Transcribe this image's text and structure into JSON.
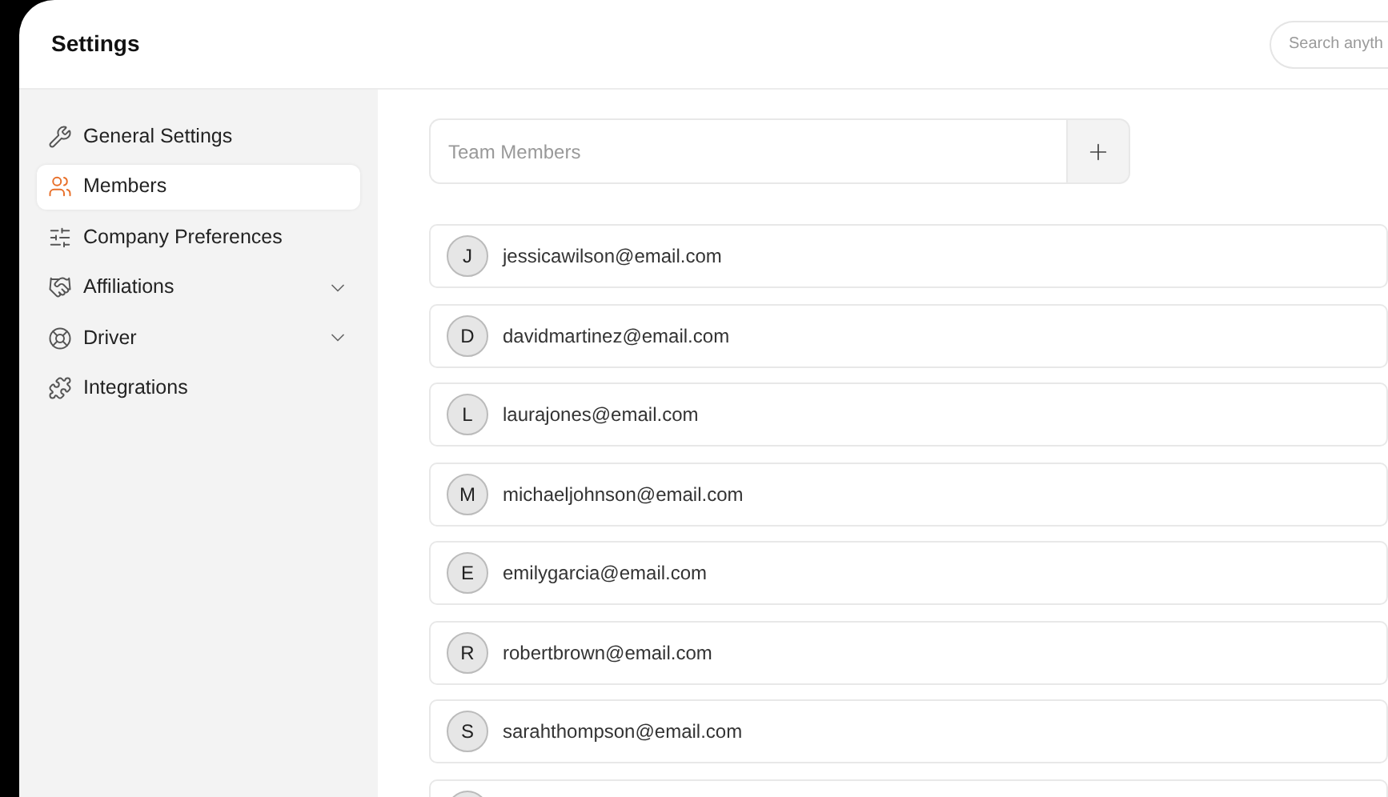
{
  "header": {
    "title": "Settings",
    "search": {
      "placeholder": "Search anyth"
    }
  },
  "sidebar": {
    "items": [
      {
        "label": "General Settings",
        "selected": false,
        "expandable": false
      },
      {
        "label": "Members",
        "selected": true,
        "expandable": false
      },
      {
        "label": "Company Preferences",
        "selected": false,
        "expandable": false
      },
      {
        "label": "Affiliations",
        "selected": false,
        "expandable": true
      },
      {
        "label": "Driver",
        "selected": false,
        "expandable": true
      },
      {
        "label": "Integrations",
        "selected": false,
        "expandable": false
      }
    ]
  },
  "team_input": {
    "placeholder": "Team Members"
  },
  "members": [
    {
      "initial": "J",
      "email": "jessicawilson@email.com"
    },
    {
      "initial": "D",
      "email": "davidmartinez@email.com"
    },
    {
      "initial": "L",
      "email": "laurajones@email.com"
    },
    {
      "initial": "M",
      "email": "michaeljohnson@email.com"
    },
    {
      "initial": "E",
      "email": "emilygarcia@email.com"
    },
    {
      "initial": "R",
      "email": "robertbrown@email.com"
    },
    {
      "initial": "S",
      "email": "sarahthompson@email.com"
    }
  ]
}
